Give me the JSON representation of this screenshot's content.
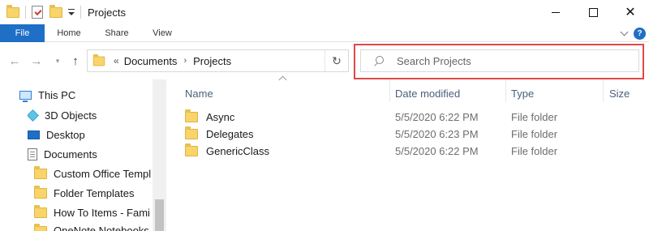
{
  "window": {
    "title": "Projects"
  },
  "ribbon": {
    "tabs": [
      "File",
      "Home",
      "Share",
      "View"
    ],
    "help": "?"
  },
  "address": {
    "overflow": "«",
    "crumbs": [
      "Documents",
      "Projects"
    ]
  },
  "search": {
    "placeholder": "Search Projects",
    "value": ""
  },
  "nav_pane": {
    "items": [
      {
        "label": "This PC",
        "icon": "this-pc-icon"
      },
      {
        "label": "3D Objects",
        "icon": "3d-objects-icon"
      },
      {
        "label": "Desktop",
        "icon": "desktop-icon"
      },
      {
        "label": "Documents",
        "icon": "documents-icon"
      },
      {
        "label": "Custom Office Templ",
        "icon": "folder-icon"
      },
      {
        "label": "Folder Templates",
        "icon": "folder-icon"
      },
      {
        "label": "How To Items - Fami",
        "icon": "folder-icon"
      },
      {
        "label": "OneNote Notebooks",
        "icon": "folder-icon"
      }
    ]
  },
  "file_list": {
    "columns": {
      "name": "Name",
      "date": "Date modified",
      "type": "Type",
      "size": "Size"
    },
    "rows": [
      {
        "name": "Async",
        "date": "5/5/2020 6:22 PM",
        "type": "File folder",
        "size": ""
      },
      {
        "name": "Delegates",
        "date": "5/5/2020 6:23 PM",
        "type": "File folder",
        "size": ""
      },
      {
        "name": "GenericClass",
        "date": "5/5/2020 6:22 PM",
        "type": "File folder",
        "size": ""
      }
    ]
  },
  "colors": {
    "accent": "#1e6fc5",
    "folder": "#f8d46b",
    "highlight_border": "#e04848"
  }
}
